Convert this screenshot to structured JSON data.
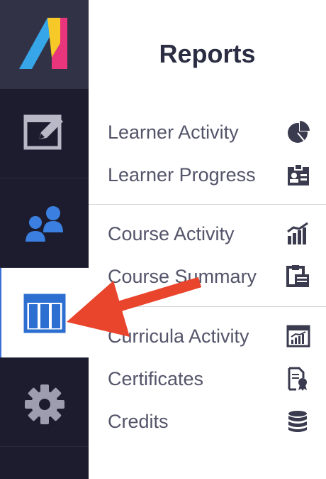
{
  "panel": {
    "title": "Reports"
  },
  "rail": {
    "items": [
      {
        "name": "edit",
        "icon": "edit-window-icon"
      },
      {
        "name": "users",
        "icon": "users-icon"
      },
      {
        "name": "reports",
        "icon": "columns-report-icon",
        "active": true
      },
      {
        "name": "settings",
        "icon": "gear-icon"
      }
    ]
  },
  "reports": {
    "groups": [
      {
        "items": [
          {
            "label": "Learner Activity",
            "icon": "pie-chart-icon"
          },
          {
            "label": "Learner Progress",
            "icon": "id-card-icon"
          }
        ]
      },
      {
        "items": [
          {
            "label": "Course Activity",
            "icon": "bar-chart-icon"
          },
          {
            "label": "Course Summary",
            "icon": "clipboard-icon"
          }
        ]
      },
      {
        "items": [
          {
            "label": "Curricula Activity",
            "icon": "chart-window-icon"
          },
          {
            "label": "Certificates",
            "icon": "certificate-icon"
          },
          {
            "label": "Credits",
            "icon": "coins-icon"
          }
        ]
      }
    ]
  },
  "colors": {
    "rail_bg": "#1c1c2e",
    "logo_bg": "#323247",
    "accent_blue": "#3b6fd6",
    "arrow_red": "#e9442c",
    "text": "#54546a",
    "title": "#2b2d42"
  }
}
